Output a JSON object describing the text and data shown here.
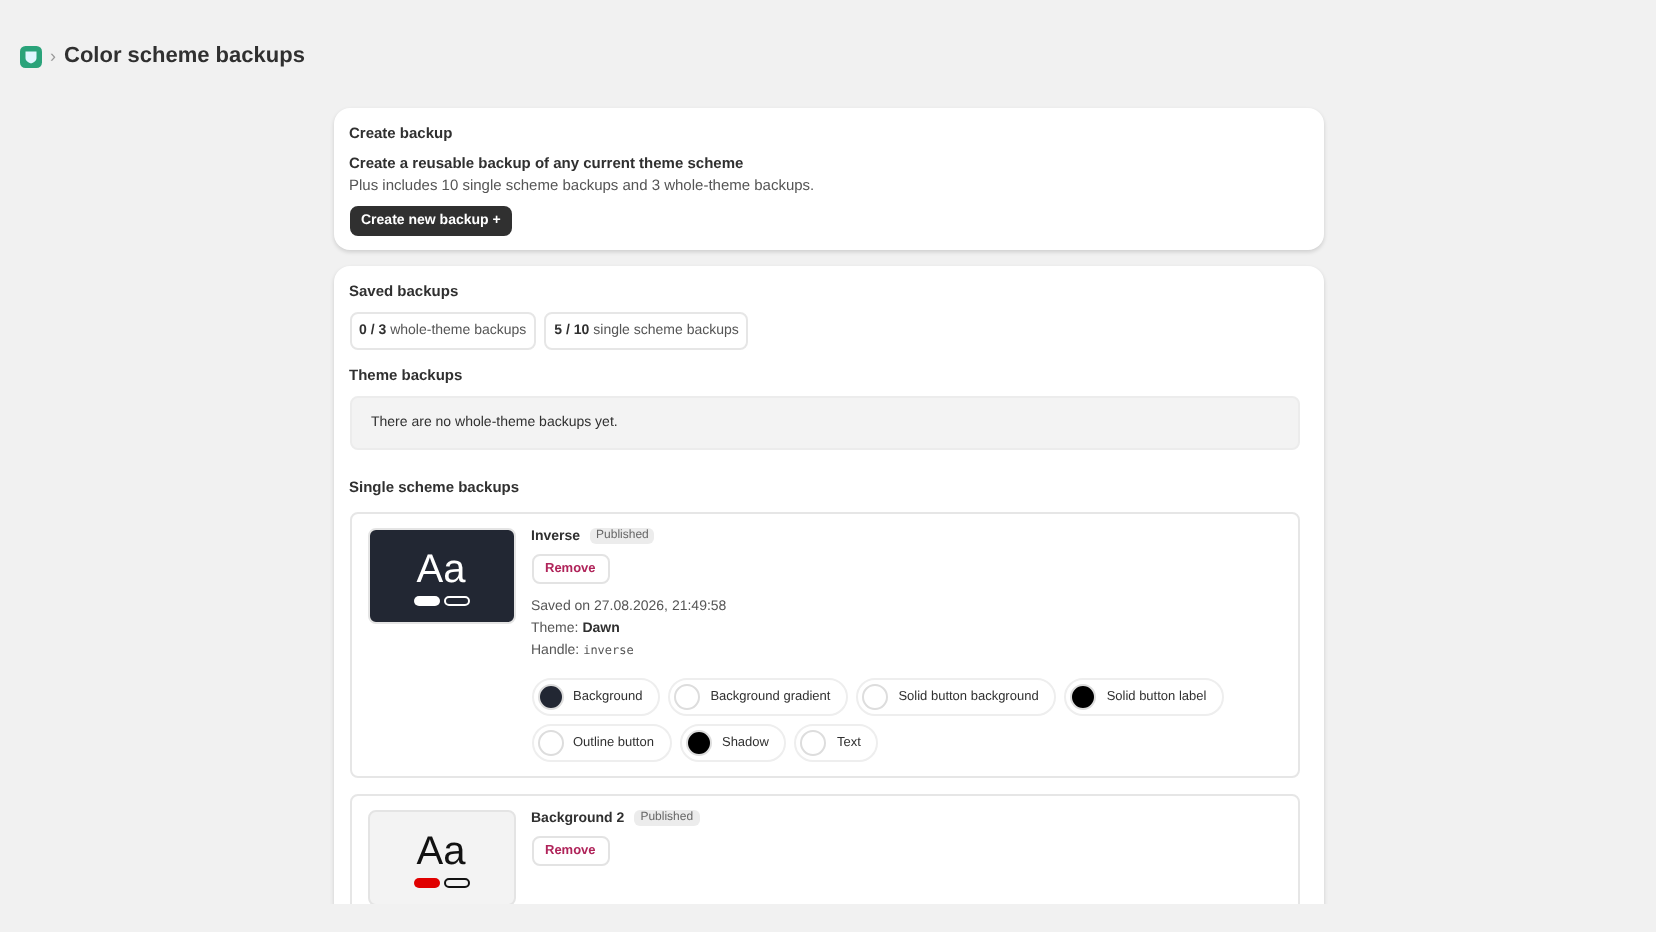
{
  "header": {
    "separator": "›",
    "title": "Color scheme backups"
  },
  "create": {
    "heading": "Create backup",
    "subheading": "Create a reusable backup of any current theme scheme",
    "description": "Plus includes 10 single scheme backups and 3 whole-theme backups.",
    "button": "Create new backup +"
  },
  "saved": {
    "heading": "Saved backups",
    "counters": [
      {
        "count": "0 / 3",
        "label": "whole-theme backups"
      },
      {
        "count": "5 / 10",
        "label": "single scheme backups"
      }
    ],
    "theme_heading": "Theme backups",
    "theme_empty": "There are no whole-theme backups yet.",
    "single_heading": "Single scheme backups",
    "schemes": [
      {
        "name": "Inverse",
        "badge": "Published",
        "remove": "Remove",
        "preview_text": "Aa",
        "preview_colors": [
          {
            "kind": "background",
            "color": "#222733"
          },
          {
            "kind": "text",
            "color": "#ffffff"
          },
          {
            "kind": "solid_button",
            "color": "#ffffff"
          },
          {
            "kind": "outline_button",
            "color": "#ffffff"
          }
        ],
        "saved": "Saved on 27.08.2026, 21:49:58",
        "theme_label": "Theme:",
        "theme": "Dawn",
        "handle_label": "Handle:",
        "handle": "inverse",
        "swatches": [
          {
            "label": "Background",
            "color": "#222733"
          },
          {
            "label": "Background gradient",
            "color": "#ffffff"
          },
          {
            "label": "Solid button background",
            "color": "#ffffff"
          },
          {
            "label": "Solid button label",
            "color": "#000000"
          },
          {
            "label": "Outline button",
            "color": "#ffffff"
          },
          {
            "label": "Shadow",
            "color": "#000000"
          },
          {
            "label": "Text",
            "color": "#ffffff"
          }
        ]
      },
      {
        "name": "Background 2",
        "badge": "Published",
        "remove": "Remove",
        "preview_text": "Aa",
        "preview_colors": [
          {
            "kind": "background",
            "color": "#f3f3f3"
          },
          {
            "kind": "text",
            "color": "#121212"
          },
          {
            "kind": "solid_button",
            "color": "#e00000"
          },
          {
            "kind": "outline_button",
            "color": "#121212"
          }
        ]
      }
    ]
  }
}
